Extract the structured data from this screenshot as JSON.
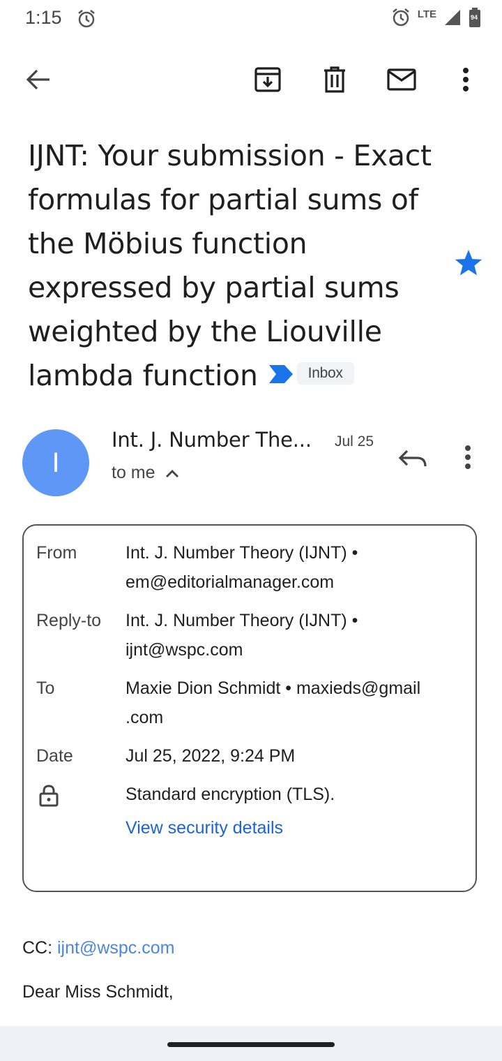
{
  "status_bar": {
    "time": "1:15",
    "network": "LTE",
    "battery": "94",
    "icons": [
      "alarm-icon",
      "signal-icon",
      "battery-icon"
    ]
  },
  "toolbar": {
    "icons": [
      "back-arrow-icon",
      "archive-icon",
      "delete-icon",
      "mark-unread-icon",
      "more-vert-icon"
    ]
  },
  "email": {
    "subject": "IJNT: Your submission - Exact formulas for partial sums of the Möbius function expressed by partial sums weighted by the Liouville lambda function",
    "label": "Inbox",
    "starred": true,
    "sender": {
      "avatar_letter": "I",
      "name_truncated": "Int. J. Number The...",
      "date": "Jul 25",
      "recipient": "to me"
    },
    "details": {
      "from_label": "From",
      "from_value_line1": "Int. J. Number Theory (IJNT) •",
      "from_value_line2": "em@editorialmanager.com",
      "replyto_label": "Reply-to",
      "replyto_value_line1": "Int. J. Number Theory (IJNT) •",
      "replyto_value_line2": "ijnt@wspc.com",
      "to_label": "To",
      "to_value_line1": "Maxie Dion Schmidt • maxieds@gmail",
      "to_value_line2": ".com",
      "date_label": "Date",
      "date_value": "Jul 25, 2022, 9:24 PM",
      "security_value": "Standard encryption (TLS).",
      "security_link": "View security details"
    },
    "body": {
      "cc_label": "CC: ",
      "cc_value": "ijnt@wspc.com",
      "greeting": "Dear Miss Schmidt,"
    }
  },
  "colors": {
    "accent_blue": "#1a73e8",
    "avatar": "#5e97f6",
    "link": "#1a64d6",
    "star": "#1a73e8"
  }
}
